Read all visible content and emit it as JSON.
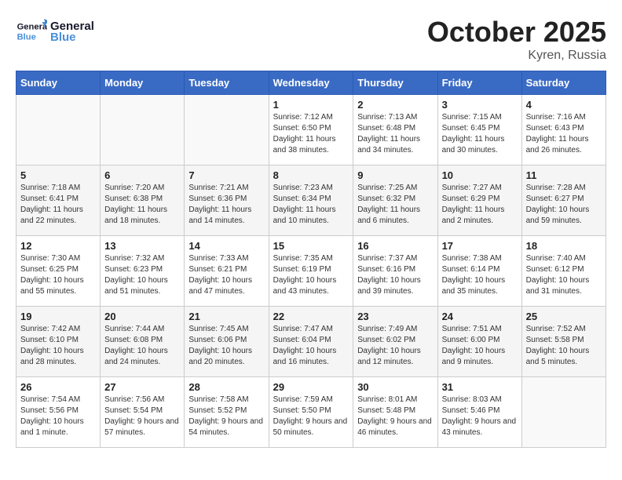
{
  "header": {
    "logo_line1": "General",
    "logo_line2": "Blue",
    "month": "October 2025",
    "location": "Kyren, Russia"
  },
  "days_of_week": [
    "Sunday",
    "Monday",
    "Tuesday",
    "Wednesday",
    "Thursday",
    "Friday",
    "Saturday"
  ],
  "weeks": [
    [
      {
        "day": "",
        "info": ""
      },
      {
        "day": "",
        "info": ""
      },
      {
        "day": "",
        "info": ""
      },
      {
        "day": "1",
        "info": "Sunrise: 7:12 AM\nSunset: 6:50 PM\nDaylight: 11 hours and 38 minutes."
      },
      {
        "day": "2",
        "info": "Sunrise: 7:13 AM\nSunset: 6:48 PM\nDaylight: 11 hours and 34 minutes."
      },
      {
        "day": "3",
        "info": "Sunrise: 7:15 AM\nSunset: 6:45 PM\nDaylight: 11 hours and 30 minutes."
      },
      {
        "day": "4",
        "info": "Sunrise: 7:16 AM\nSunset: 6:43 PM\nDaylight: 11 hours and 26 minutes."
      }
    ],
    [
      {
        "day": "5",
        "info": "Sunrise: 7:18 AM\nSunset: 6:41 PM\nDaylight: 11 hours and 22 minutes."
      },
      {
        "day": "6",
        "info": "Sunrise: 7:20 AM\nSunset: 6:38 PM\nDaylight: 11 hours and 18 minutes."
      },
      {
        "day": "7",
        "info": "Sunrise: 7:21 AM\nSunset: 6:36 PM\nDaylight: 11 hours and 14 minutes."
      },
      {
        "day": "8",
        "info": "Sunrise: 7:23 AM\nSunset: 6:34 PM\nDaylight: 11 hours and 10 minutes."
      },
      {
        "day": "9",
        "info": "Sunrise: 7:25 AM\nSunset: 6:32 PM\nDaylight: 11 hours and 6 minutes."
      },
      {
        "day": "10",
        "info": "Sunrise: 7:27 AM\nSunset: 6:29 PM\nDaylight: 11 hours and 2 minutes."
      },
      {
        "day": "11",
        "info": "Sunrise: 7:28 AM\nSunset: 6:27 PM\nDaylight: 10 hours and 59 minutes."
      }
    ],
    [
      {
        "day": "12",
        "info": "Sunrise: 7:30 AM\nSunset: 6:25 PM\nDaylight: 10 hours and 55 minutes."
      },
      {
        "day": "13",
        "info": "Sunrise: 7:32 AM\nSunset: 6:23 PM\nDaylight: 10 hours and 51 minutes."
      },
      {
        "day": "14",
        "info": "Sunrise: 7:33 AM\nSunset: 6:21 PM\nDaylight: 10 hours and 47 minutes."
      },
      {
        "day": "15",
        "info": "Sunrise: 7:35 AM\nSunset: 6:19 PM\nDaylight: 10 hours and 43 minutes."
      },
      {
        "day": "16",
        "info": "Sunrise: 7:37 AM\nSunset: 6:16 PM\nDaylight: 10 hours and 39 minutes."
      },
      {
        "day": "17",
        "info": "Sunrise: 7:38 AM\nSunset: 6:14 PM\nDaylight: 10 hours and 35 minutes."
      },
      {
        "day": "18",
        "info": "Sunrise: 7:40 AM\nSunset: 6:12 PM\nDaylight: 10 hours and 31 minutes."
      }
    ],
    [
      {
        "day": "19",
        "info": "Sunrise: 7:42 AM\nSunset: 6:10 PM\nDaylight: 10 hours and 28 minutes."
      },
      {
        "day": "20",
        "info": "Sunrise: 7:44 AM\nSunset: 6:08 PM\nDaylight: 10 hours and 24 minutes."
      },
      {
        "day": "21",
        "info": "Sunrise: 7:45 AM\nSunset: 6:06 PM\nDaylight: 10 hours and 20 minutes."
      },
      {
        "day": "22",
        "info": "Sunrise: 7:47 AM\nSunset: 6:04 PM\nDaylight: 10 hours and 16 minutes."
      },
      {
        "day": "23",
        "info": "Sunrise: 7:49 AM\nSunset: 6:02 PM\nDaylight: 10 hours and 12 minutes."
      },
      {
        "day": "24",
        "info": "Sunrise: 7:51 AM\nSunset: 6:00 PM\nDaylight: 10 hours and 9 minutes."
      },
      {
        "day": "25",
        "info": "Sunrise: 7:52 AM\nSunset: 5:58 PM\nDaylight: 10 hours and 5 minutes."
      }
    ],
    [
      {
        "day": "26",
        "info": "Sunrise: 7:54 AM\nSunset: 5:56 PM\nDaylight: 10 hours and 1 minute."
      },
      {
        "day": "27",
        "info": "Sunrise: 7:56 AM\nSunset: 5:54 PM\nDaylight: 9 hours and 57 minutes."
      },
      {
        "day": "28",
        "info": "Sunrise: 7:58 AM\nSunset: 5:52 PM\nDaylight: 9 hours and 54 minutes."
      },
      {
        "day": "29",
        "info": "Sunrise: 7:59 AM\nSunset: 5:50 PM\nDaylight: 9 hours and 50 minutes."
      },
      {
        "day": "30",
        "info": "Sunrise: 8:01 AM\nSunset: 5:48 PM\nDaylight: 9 hours and 46 minutes."
      },
      {
        "day": "31",
        "info": "Sunrise: 8:03 AM\nSunset: 5:46 PM\nDaylight: 9 hours and 43 minutes."
      },
      {
        "day": "",
        "info": ""
      }
    ]
  ]
}
